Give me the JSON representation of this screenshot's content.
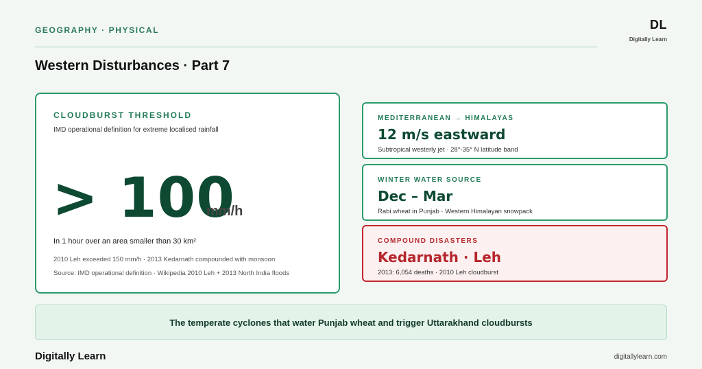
{
  "header": {
    "kicker": "GEOGRAPHY · PHYSICAL",
    "title": "Western Disturbances · Part 7",
    "logo_mark": "DL",
    "logo_sub": "Digitally Learn"
  },
  "main_card": {
    "label": "CLOUDBURST THRESHOLD",
    "description": "IMD operational definition for extreme localised rainfall",
    "value": "> 100",
    "unit": "mm/h",
    "line1": "In 1 hour over an area smaller than 30 km²",
    "line2": "2010 Leh exceeded 150 mm/h · 2013 Kedarnath compounded with monsoon",
    "line3": "Source: IMD operational definition · Wikipedia 2010 Leh + 2013 North India floods"
  },
  "cards": [
    {
      "label": "MEDITERRANEAN → HIMALAYAS",
      "value": "12 m/s eastward",
      "sub": "Subtropical westerly jet · 28°-35° N latitude band"
    },
    {
      "label": "WINTER WATER SOURCE",
      "value": "Dec – Mar",
      "sub": "Rabi wheat in Punjab · Western Himalayan snowpack"
    },
    {
      "label": "COMPOUND DISASTERS",
      "value": "Kedarnath · Leh",
      "sub": "2013: 6,054 deaths · 2010 Leh cloudburst"
    }
  ],
  "banner": {
    "text": "The temperate cyclones that water Punjab wheat and trigger Uttarakhand cloudbursts"
  },
  "footer": {
    "brand": "Digitally Learn",
    "url": "digitallylearn.com"
  },
  "colors": {
    "accent": "#2a9b6a",
    "dark_green": "#0e4a32",
    "alert_red": "#b5262c",
    "background": "#f2f7f3"
  }
}
